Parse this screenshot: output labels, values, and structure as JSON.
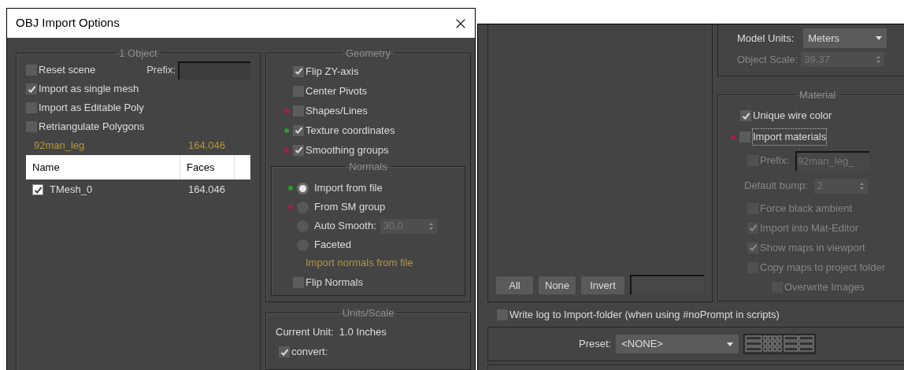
{
  "left_window": {
    "title": "OBJ Import Options",
    "object_group": {
      "title": "1 Object",
      "prefix_label": "Prefix:",
      "options": [
        {
          "label": "Reset scene",
          "checked": false
        },
        {
          "label": "Import as single mesh",
          "checked": true
        },
        {
          "label": "Import as Editable Poly",
          "checked": false
        },
        {
          "label": "Retriangulate Polygons",
          "checked": false
        }
      ],
      "summary": {
        "name": "92man_leg",
        "faces": "164.046"
      },
      "table": {
        "columns": [
          "Name",
          "Faces"
        ],
        "rows": [
          {
            "name": "TMesh_0",
            "faces": "164.046",
            "checked": true
          }
        ]
      }
    },
    "geometry": {
      "title": "Geometry",
      "options": [
        {
          "label": "Flip ZY-axis",
          "checked": true
        },
        {
          "label": "Center Pivots",
          "checked": false
        },
        {
          "label": "Shapes/Lines",
          "checked": false,
          "color": "#a3204a"
        },
        {
          "label": "Texture coordinates",
          "checked": true,
          "color": "#2e9a2e"
        },
        {
          "label": "Smoothing groups",
          "checked": true,
          "color": "#a3204a"
        }
      ]
    },
    "normals": {
      "title": "Normals",
      "options": [
        {
          "label": "Import from file",
          "selected": true,
          "color": "#2e9a2e"
        },
        {
          "label": "From SM group",
          "selected": false,
          "color": "#a3204a"
        },
        {
          "label": "Auto Smooth:",
          "selected": false,
          "value": "30,0"
        },
        {
          "label": "Faceted",
          "selected": false
        }
      ],
      "note": "Import normals from file",
      "flip_normals": {
        "label": "Flip Normals",
        "checked": false
      }
    },
    "units": {
      "title": "Units/Scale",
      "current_unit_label": "Current Unit:",
      "current_unit": "1.0 Inches",
      "convert": {
        "label": "convert:",
        "checked": true
      }
    }
  },
  "right_window": {
    "selection_buttons": [
      "All",
      "None",
      "Invert"
    ],
    "model_units": {
      "label": "Model Units:",
      "value": "Meters"
    },
    "object_scale": {
      "label": "Object Scale:",
      "value": "39,37",
      "disabled": true
    },
    "material": {
      "title": "Material",
      "unique_wire_color": {
        "label": "Unique wire color",
        "checked": true
      },
      "import_materials": {
        "label": "Import materials",
        "checked": false,
        "color": "#a3204a",
        "focused": true
      },
      "prefix": {
        "label": "Prefix:",
        "checked": false,
        "value": "92man_leg_",
        "disabled": true
      },
      "default_bump": {
        "label": "Default bump:",
        "value": "2",
        "disabled": true
      },
      "options": [
        {
          "label": "Force black ambient",
          "checked": false,
          "disabled": true
        },
        {
          "label": "Import into Mat-Editor",
          "checked": true,
          "disabled": true
        },
        {
          "label": "Show maps in viewport",
          "checked": true,
          "disabled": true
        },
        {
          "label": "Copy maps to project folder",
          "checked": false,
          "disabled": true,
          "children": [
            {
              "label": "Overwrite Images",
              "checked": false,
              "disabled": true
            }
          ]
        }
      ]
    },
    "write_log": {
      "label": "Write log to Import-folder (when using #noPrompt in scripts)",
      "checked": false
    },
    "preset": {
      "label": "Preset:",
      "value": "<NONE>"
    }
  }
}
